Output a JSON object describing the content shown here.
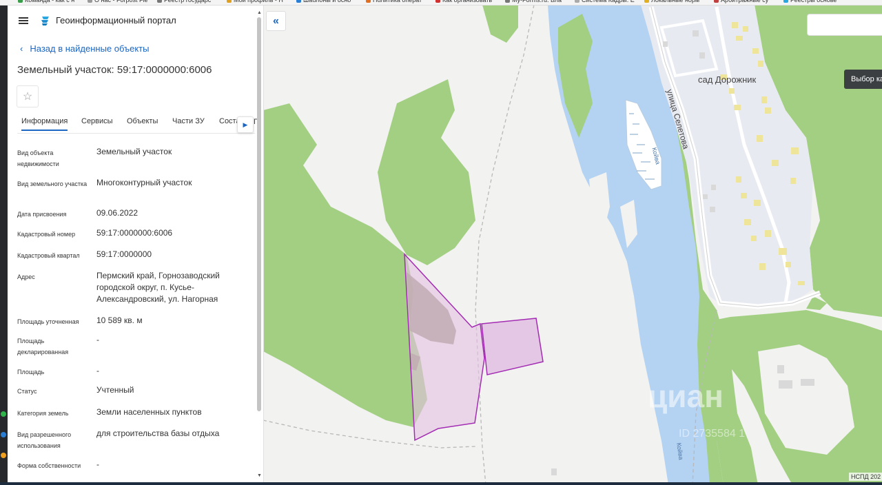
{
  "browser": {
    "bookmarks": [
      "Команда - как с н",
      "О нас - Forpost Fie",
      "Реестр государс",
      "Мой профиль - Н",
      "Шаблоны и осно",
      "Политика операт",
      "Как организовать",
      "My-Forms.ru. Бла",
      "Система Кадры. Е",
      "Локальные норм",
      "Арбитражные су",
      "Реестры основе"
    ]
  },
  "header": {
    "title": "Геоинформационный портал"
  },
  "nav": {
    "back_label": "Назад в найденные объекты"
  },
  "object": {
    "title": "Земельный участок: 59:17:0000000:6006"
  },
  "tabs": [
    {
      "label": "Информация",
      "active": true
    },
    {
      "label": "Сервисы"
    },
    {
      "label": "Объекты"
    },
    {
      "label": "Части ЗУ"
    },
    {
      "label": "Соста"
    }
  ],
  "tabs_more": "П",
  "info": [
    {
      "label": "Вид объекта недвижимости",
      "value": "Земельный участок"
    },
    {
      "label": "Вид земельного участка",
      "value": "Многоконтурный участок"
    },
    {
      "label": "Дата присвоения",
      "value": "09.06.2022"
    },
    {
      "label": "Кадастровый номер",
      "value": "59:17:0000000:6006"
    },
    {
      "label": "Кадастровый квартал",
      "value": "59:17:0000000"
    },
    {
      "label": "Адрес",
      "value": "Пермский край, Горнозаводский городской округ, п. Кусье-Александровский, ул. Нагорная"
    },
    {
      "label": "Площадь уточненная",
      "value": "10 589 кв. м"
    },
    {
      "label": "Площадь декларированная",
      "value": "-"
    },
    {
      "label": "Площадь",
      "value": "-"
    },
    {
      "label": "Статус",
      "value": "Учтенный"
    },
    {
      "label": "Категория земель",
      "value": "Земли населенных пунктов"
    },
    {
      "label": "Вид разрешенного использования",
      "value": "для строительства базы отдыха"
    },
    {
      "label": "Форма собственности",
      "value": "-"
    }
  ],
  "map": {
    "tooltip": "Выбор ка",
    "place_label": "сад Дорожник",
    "street_label": "улица Селетова",
    "river_label": "Койва",
    "watermark": "циан",
    "watermark_id": "ID 2735584 1",
    "attribution": "НСПД 202",
    "colors": {
      "water": "#b4d2f2",
      "forest": "#a3cf83",
      "parcel_fill": "#e2bfe2",
      "parcel_stroke": "#a32cb3",
      "building": "#efe59a",
      "residential": "#e8eaf2"
    }
  },
  "icons": [
    "menu-icon",
    "portal-logo-icon",
    "chevron-left-icon",
    "star-icon",
    "chevron-right-icon",
    "collapse-double-chevron-icon"
  ]
}
